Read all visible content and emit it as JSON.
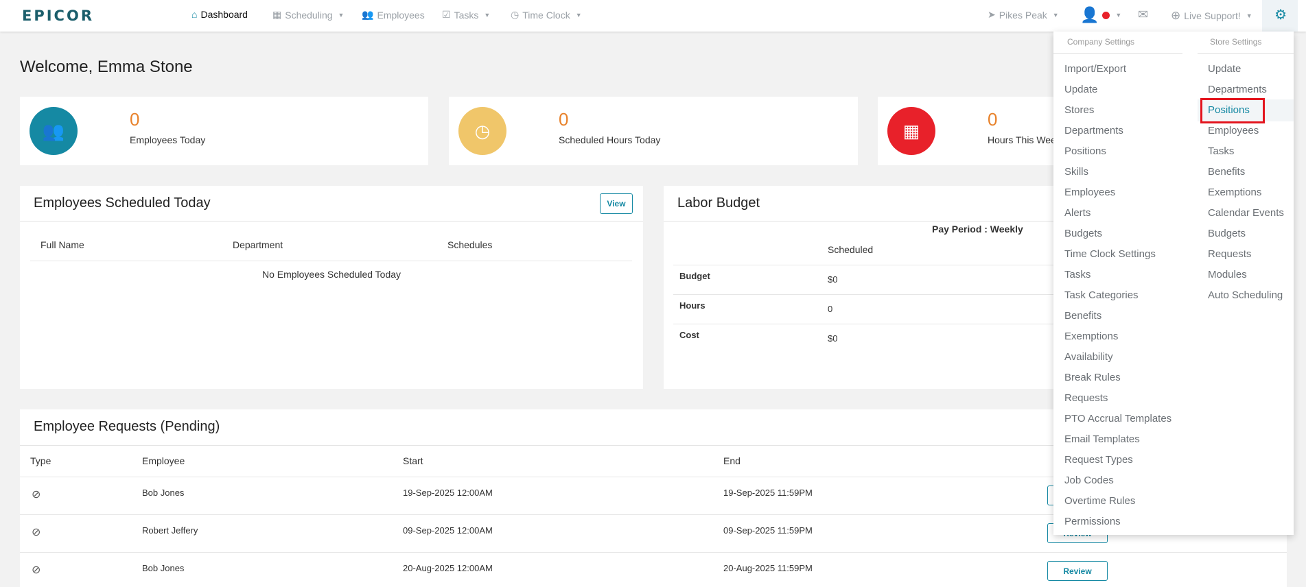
{
  "nav": {
    "logo": "EPICOR",
    "items": [
      {
        "label": "Dashboard",
        "icon": "home-icon",
        "active": true
      },
      {
        "label": "Scheduling",
        "icon": "calendar-icon",
        "caret": true
      },
      {
        "label": "Employees",
        "icon": "users-icon"
      },
      {
        "label": "Tasks",
        "icon": "check-square-icon",
        "caret": true
      },
      {
        "label": "Time Clock",
        "icon": "clock-icon",
        "caret": true
      }
    ],
    "store": "Pikes Peak",
    "support": "Live Support!"
  },
  "welcome": "Welcome, Emma Stone",
  "stats": [
    {
      "value": "0",
      "label": "Employees Today",
      "color": "#1589a3",
      "icon": "users-icon"
    },
    {
      "value": "0",
      "label": "Scheduled Hours Today",
      "color": "#f0c66a",
      "icon": "clock-icon"
    },
    {
      "value": "0",
      "label": "Hours This Week",
      "color": "#e8212a",
      "icon": "calendar-icon"
    }
  ],
  "scheduled_today": {
    "title": "Employees Scheduled Today",
    "view_label": "View",
    "columns": [
      "Full Name",
      "Department",
      "Schedules"
    ],
    "empty": "No Employees Scheduled Today"
  },
  "labor_budget": {
    "title": "Labor Budget",
    "period": "Pay Period : Weekly",
    "column": "Scheduled",
    "rows": [
      {
        "label": "Budget",
        "value": "$0"
      },
      {
        "label": "Hours",
        "value": "0"
      },
      {
        "label": "Cost",
        "value": "$0"
      }
    ]
  },
  "requests": {
    "title": "Employee Requests (Pending)",
    "columns": [
      "Type",
      "Employee",
      "Start",
      "End"
    ],
    "rows": [
      {
        "employee": "Bob Jones",
        "start": "19-Sep-2025 12:00AM",
        "end": "19-Sep-2025 11:59PM"
      },
      {
        "employee": "Robert Jeffery",
        "start": "09-Sep-2025 12:00AM",
        "end": "09-Sep-2025 11:59PM"
      },
      {
        "employee": "Bob Jones",
        "start": "20-Aug-2025 12:00AM",
        "end": "20-Aug-2025 11:59PM"
      }
    ],
    "review_label": "Review"
  },
  "settings_menu": {
    "company_header": "Company Settings",
    "store_header": "Store Settings",
    "company_items": [
      "Import/Export",
      "Update",
      "Stores",
      "Departments",
      "Positions",
      "Skills",
      "Employees",
      "Alerts",
      "Budgets",
      "Time Clock Settings",
      "Tasks",
      "Task Categories",
      "Benefits",
      "Exemptions",
      "Availability",
      "Break Rules",
      "Requests",
      "PTO Accrual Templates",
      "Email Templates",
      "Request Types",
      "Job Codes",
      "Overtime Rules",
      "Permissions"
    ],
    "store_items": [
      "Update",
      "Departments",
      "Positions",
      "Employees",
      "Tasks",
      "Benefits",
      "Exemptions",
      "Calendar Events",
      "Budgets",
      "Requests",
      "Modules",
      "Auto Scheduling"
    ],
    "highlighted_store_item": "Positions"
  }
}
